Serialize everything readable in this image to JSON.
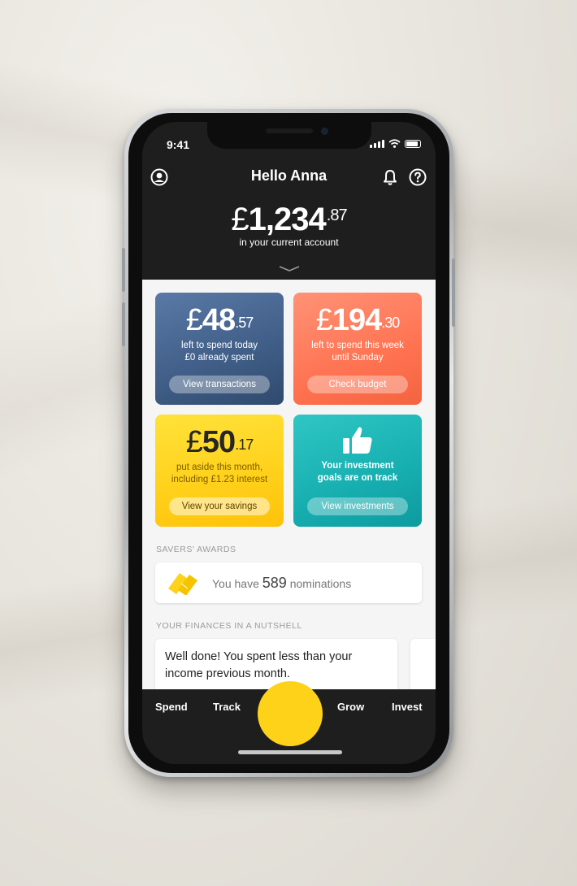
{
  "status": {
    "time": "9:41"
  },
  "header": {
    "title": "Hello Anna"
  },
  "balance": {
    "currency": "£",
    "whole": "1,234",
    "pence": "87",
    "caption": "in your current account"
  },
  "cards": [
    {
      "currency": "£",
      "whole": "48",
      "pence": "57",
      "line1": "left to spend today",
      "line2": "£0 already spent",
      "button": "View transactions"
    },
    {
      "currency": "£",
      "whole": "194",
      "pence": "30",
      "line1": "left to spend this week",
      "line2": "until Sunday",
      "button": "Check budget"
    },
    {
      "currency": "£",
      "whole": "50",
      "pence": "17",
      "line1": "put aside this month,",
      "line2": "including £1.23 interest",
      "button": "View your savings"
    },
    {
      "line1": "Your investment",
      "line2": "goals are on track",
      "button": "View investments"
    }
  ],
  "awards": {
    "section_title": "SAVERS' AWARDS",
    "prefix": "You have",
    "count": "589",
    "suffix": "nominations"
  },
  "nutshell": {
    "section_title": "YOUR FINANCES IN A NUTSHELL",
    "message": "Well done! You spent less than your income previous month."
  },
  "tabs": [
    "Spend",
    "Track",
    "Grow",
    "Invest"
  ],
  "colors": {
    "accent_yellow": "#ffd21a",
    "blue_card": "#3f5d86",
    "orange_card": "#ff7352",
    "yellow_card": "#ffd01a",
    "teal_card": "#17aeb0"
  }
}
